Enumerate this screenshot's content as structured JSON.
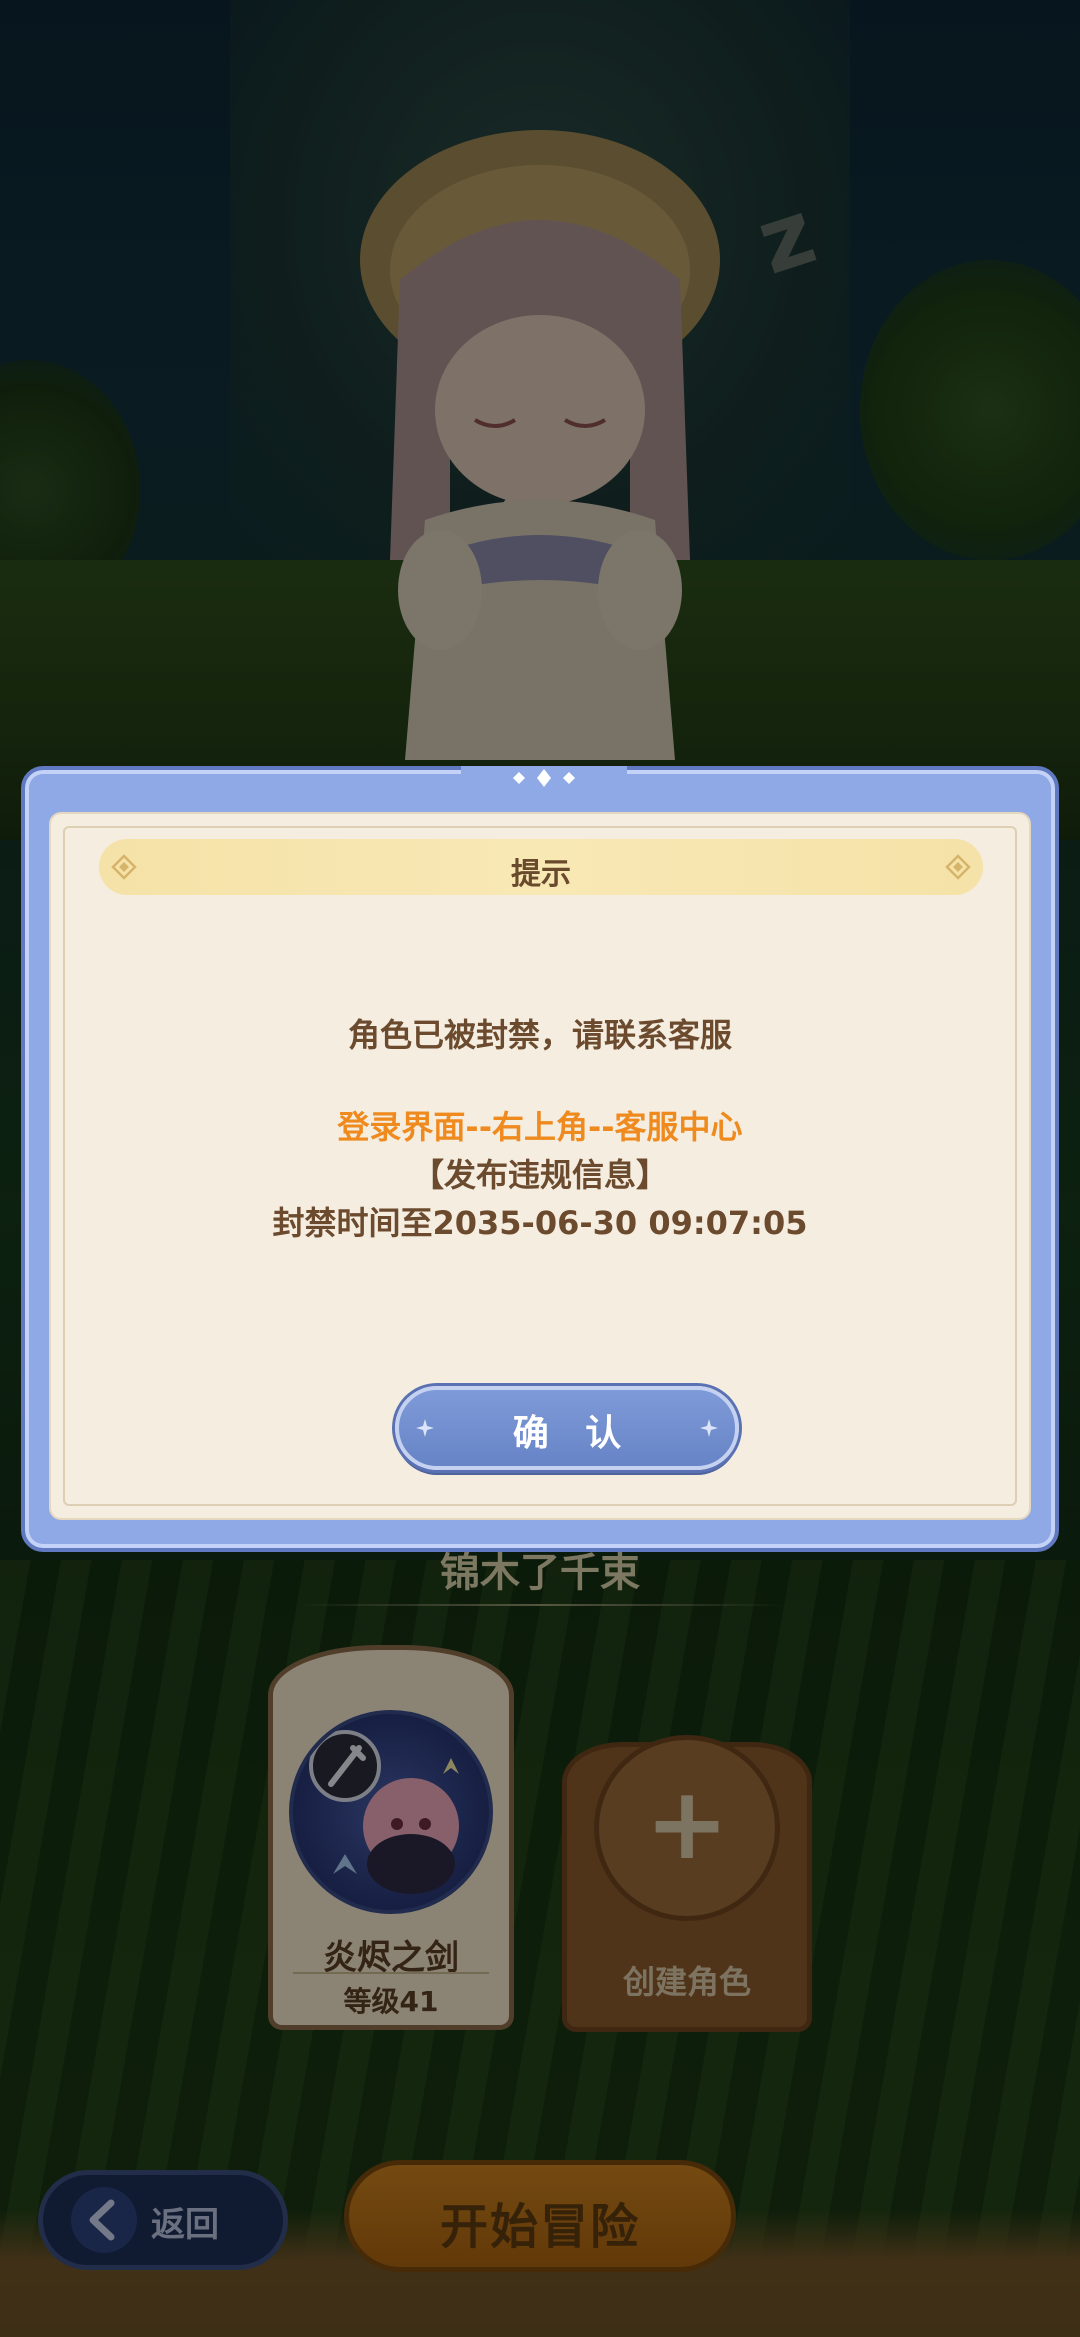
{
  "dialog": {
    "title": "提示",
    "message": "角色已被封禁，请联系客服",
    "support_path": "登录界面--右上角--客服中心",
    "reason": "【发布违规信息】",
    "ban_until": "封禁时间至2035-06-30  09:07:05",
    "confirm_label": "确 认"
  },
  "character_select": {
    "selected_name": "锦木了千束",
    "slots": [
      {
        "name": "炎烬之剑",
        "level": "等级41"
      }
    ],
    "create_label": "创建角色"
  },
  "bottom_bar": {
    "back_label": "返回",
    "start_label": "开始冒险"
  },
  "colors": {
    "dialog_accent": "#8fa8e6",
    "dialog_body": "#f4ede0",
    "highlight_text": "#ef8a1f",
    "body_text": "#6b4a2e",
    "confirm_button": "#6f8dcf"
  }
}
